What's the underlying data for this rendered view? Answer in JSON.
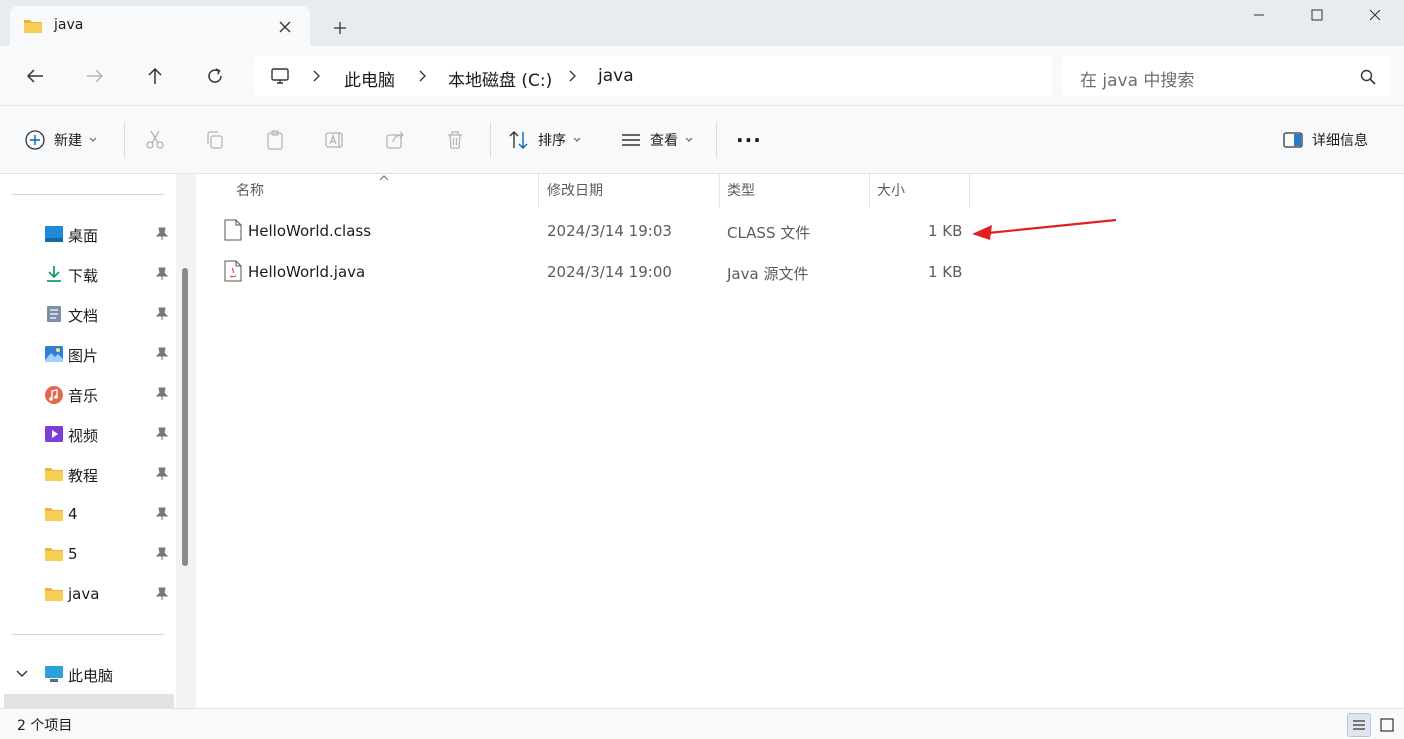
{
  "tab": {
    "title": "java"
  },
  "address": {
    "crumbs": [
      "此电脑",
      "本地磁盘 (C:)",
      "java"
    ]
  },
  "search": {
    "placeholder": "在 java 中搜索"
  },
  "toolbar": {
    "new_label": "新建",
    "sort_label": "排序",
    "view_label": "查看",
    "more_label": "···",
    "details_label": "详细信息"
  },
  "sidebar": {
    "items": [
      {
        "label": "桌面",
        "icon": "desktop-icon"
      },
      {
        "label": "下载",
        "icon": "download-icon"
      },
      {
        "label": "文档",
        "icon": "document-icon"
      },
      {
        "label": "图片",
        "icon": "pictures-icon"
      },
      {
        "label": "音乐",
        "icon": "music-icon"
      },
      {
        "label": "视频",
        "icon": "video-icon"
      },
      {
        "label": "教程",
        "icon": "folder-icon"
      },
      {
        "label": "4",
        "icon": "folder-icon"
      },
      {
        "label": "5",
        "icon": "folder-icon"
      },
      {
        "label": "java",
        "icon": "folder-icon"
      }
    ],
    "this_pc": {
      "label": "此电脑",
      "icon": "computer-icon"
    }
  },
  "table": {
    "columns": [
      "名称",
      "修改日期",
      "类型",
      "大小"
    ],
    "rows": [
      {
        "name": "HelloWorld.class",
        "modified": "2024/3/14 19:03",
        "type": "CLASS 文件",
        "size": "1 KB",
        "icon": "file-icon"
      },
      {
        "name": "HelloWorld.java",
        "modified": "2024/3/14 19:00",
        "type": "Java 源文件",
        "size": "1 KB",
        "icon": "java-file-icon"
      }
    ]
  },
  "status": {
    "text": "2 个项目"
  },
  "colors": {
    "accent": "#0067c0",
    "folder": "#f4c542",
    "arrow": "#e02020"
  }
}
